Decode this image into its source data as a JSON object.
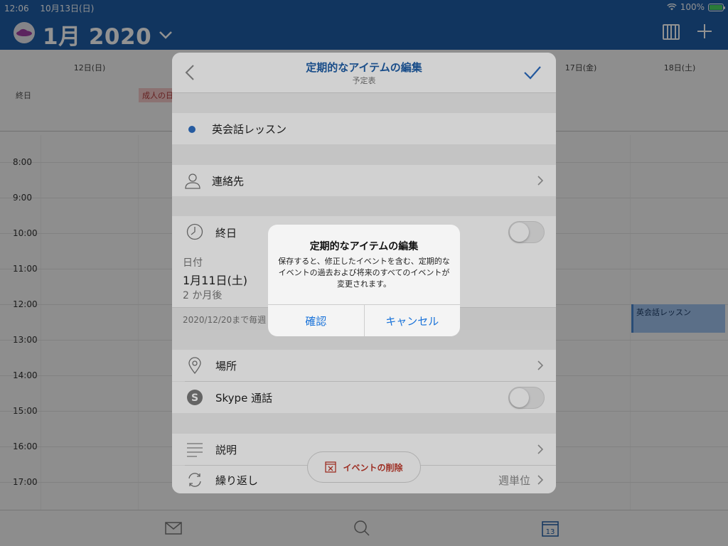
{
  "status_bar": {
    "time": "12:06",
    "date": "10月13日(日)",
    "battery": "100%",
    "battery_level": 1.0
  },
  "header": {
    "month_title": "1月 2020",
    "icons": [
      "avatar-icon",
      "chevron-down-icon",
      "column-view-icon",
      "plus-icon"
    ]
  },
  "calendar": {
    "day_headers": [
      "12日(日)",
      "17日(金)",
      "18日(土)"
    ],
    "allday_label": "終日",
    "holiday_label": "成人の日",
    "hours": [
      "8:00",
      "9:00",
      "10:00",
      "11:00",
      "12:00",
      "13:00",
      "14:00",
      "15:00",
      "16:00",
      "17:00"
    ],
    "event_label": "英会話レッスン"
  },
  "sheet": {
    "title": "定期的なアイテムの編集",
    "subtitle": "予定表",
    "event_name": "英会話レッスン",
    "event_color": "#2f6fc4",
    "contacts_label": "連絡先",
    "allday_label": "終日",
    "allday_on": false,
    "date_caption": "日付",
    "date_value": "1月11日(土)",
    "date_relative": "2 か月後",
    "repeat_note": "2020/12/20まで毎週",
    "location_label": "場所",
    "skype_label": "Skype 通話",
    "skype_on": false,
    "description_label": "説明",
    "repeat_label": "繰り返し",
    "repeat_value": "週単位",
    "delete_label": "イベントの削除"
  },
  "alert": {
    "title": "定期的なアイテムの編集",
    "message": "保存すると、修正したイベントを含む、定期的なイベントの過去および将来のすべてのイベントが変更されます。",
    "confirm_label": "確認",
    "cancel_label": "キャンセル"
  },
  "tabbar": {
    "calendar_day": "13",
    "icons": [
      "mail-icon",
      "search-icon",
      "calendar-icon"
    ]
  },
  "colors": {
    "brand": "#1f5ea8",
    "accent": "#1a73d9",
    "destructive": "#c0392b"
  }
}
